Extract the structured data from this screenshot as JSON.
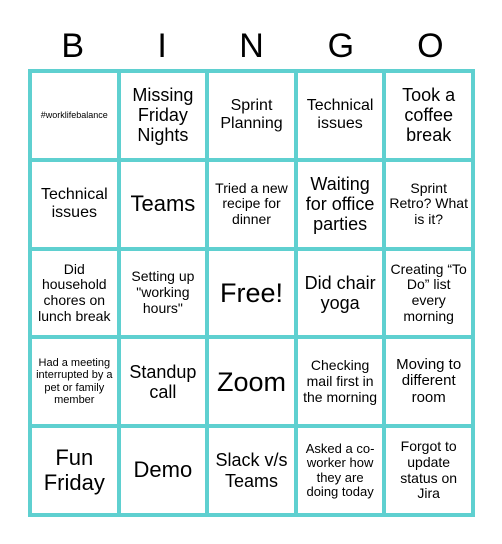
{
  "title_letters": [
    "B",
    "I",
    "N",
    "G",
    "O"
  ],
  "colors": {
    "grid_border": "#5fd0d0",
    "cell_background": "#ffffff",
    "text": "#000000"
  },
  "cells": [
    [
      "#worklifebalance",
      "Missing Friday Nights",
      "Sprint Planning",
      "Technical issues",
      "Took a coffee break"
    ],
    [
      "Technical issues",
      "Teams",
      "Tried a new recipe for dinner",
      "Waiting for office parties",
      "Sprint Retro? What is it?"
    ],
    [
      "Did household chores on lunch break",
      "Setting up \"working hours\"",
      "Free!",
      "Did chair yoga",
      "Creating “To Do” list every morning"
    ],
    [
      "Had a meeting interrupted by a pet or family member",
      "Standup call",
      "Zoom",
      "Checking mail first in the morning",
      "Moving to different room"
    ],
    [
      "Fun Friday",
      "Demo",
      "Slack v/s Teams",
      "Asked a co-worker how they are doing today",
      "Forgot to update status on Jira"
    ]
  ]
}
